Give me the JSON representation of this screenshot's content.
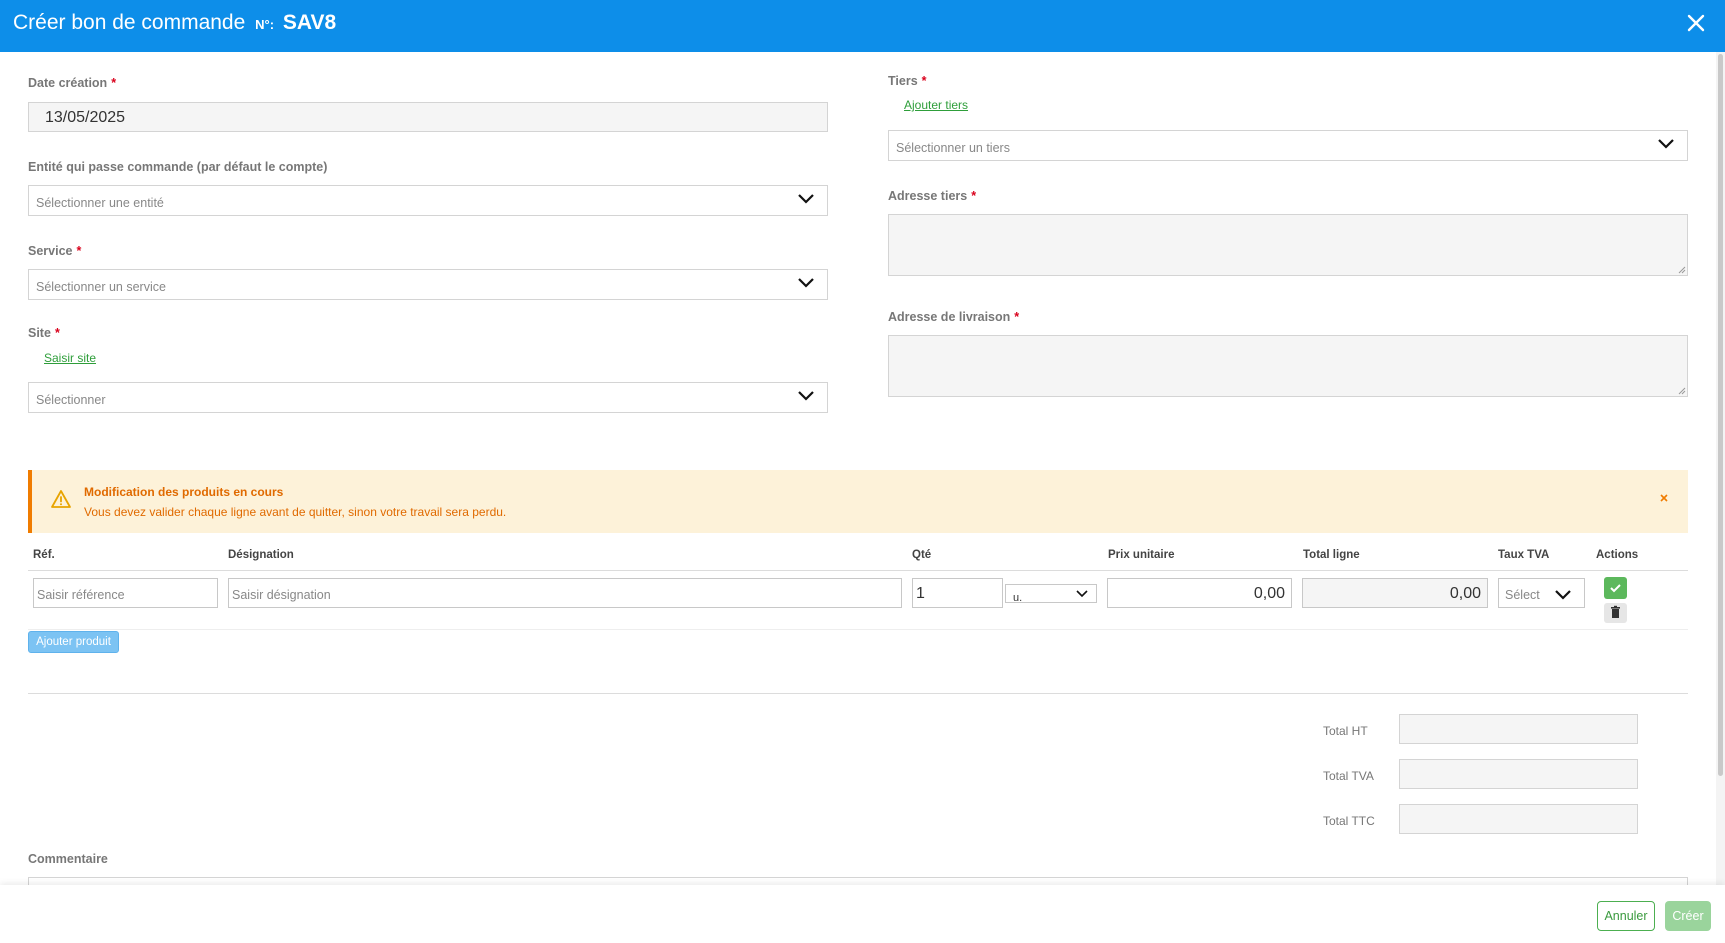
{
  "header": {
    "title": "Créer bon de commande",
    "no_label": "N°:",
    "code": "SAV8",
    "close_icon": "close-icon"
  },
  "form": {
    "date_creation": {
      "label": "Date création",
      "required": "*",
      "value": "13/05/2025"
    },
    "entite": {
      "label": "Entité qui passe commande (par défaut le compte)",
      "placeholder": "Sélectionner une entité"
    },
    "service": {
      "label": "Service",
      "required": "*",
      "placeholder": "Sélectionner un service"
    },
    "site": {
      "label": "Site",
      "required": "*",
      "link": "Saisir site",
      "placeholder": "Sélectionner"
    },
    "tiers": {
      "label": "Tiers",
      "required": "*",
      "link": "Ajouter tiers",
      "placeholder": "Sélectionner un tiers"
    },
    "adresse_tiers": {
      "label": "Adresse tiers",
      "required": "*"
    },
    "adresse_livraison": {
      "label": "Adresse de livraison",
      "required": "*"
    }
  },
  "alert": {
    "title": "Modification des produits en cours",
    "message": "Vous devez valider chaque ligne avant de quitter, sinon votre travail sera perdu.",
    "icon": "warning-icon",
    "color": "#f07c00"
  },
  "products": {
    "headers": [
      "Réf.",
      "Désignation",
      "Qté",
      "Prix unitaire",
      "Total ligne",
      "Taux TVA",
      "Actions"
    ],
    "row": {
      "ref_placeholder": "Saisir référence",
      "designation_placeholder": "Saisir désignation",
      "qty": "1",
      "unit": "u.",
      "unit_price": "0,00",
      "total_line": "0,00",
      "tva_placeholder": "Sélect"
    },
    "add_button": "Ajouter produit"
  },
  "totals": {
    "ht_label": "Total HT",
    "tva_label": "Total TVA",
    "ttc_label": "Total TTC"
  },
  "comment": {
    "label": "Commentaire"
  },
  "footer": {
    "cancel": "Annuler",
    "create": "Créer"
  },
  "colors": {
    "header": "#0d8ee9",
    "accent_green": "#4caf50",
    "required": "#d9001b"
  }
}
